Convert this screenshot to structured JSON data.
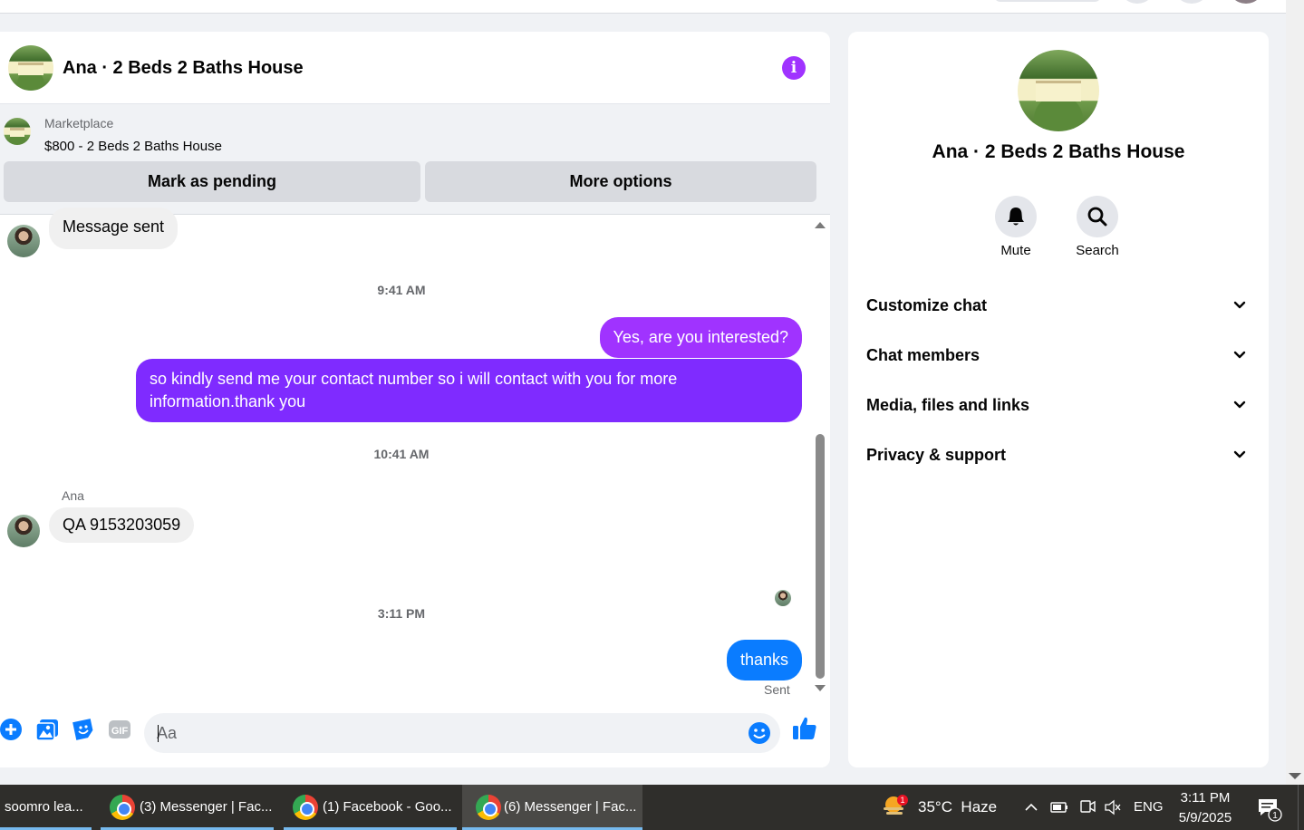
{
  "chat": {
    "title": "Ana · 2 Beds 2 Baths House",
    "info_icon": "info-icon",
    "marketplace": {
      "label": "Marketplace",
      "listing": "$800 - 2 Beds 2 Baths House",
      "mark_pending": "Mark as pending",
      "more_options": "More options"
    },
    "messages": {
      "msg1": "Message sent",
      "time1": "9:41 AM",
      "msg2": "Yes, are you interested?",
      "msg3": "so kindly send me your contact number so i will contact with you for more information.thank you",
      "time2": "10:41 AM",
      "sender": "Ana",
      "msg4": "QA 9153203059",
      "time3": "3:11 PM",
      "msg5": "thanks",
      "status": "Sent"
    },
    "composer": {
      "placeholder": "Aa",
      "icons": [
        "plus-icon",
        "image-icon",
        "sticker-icon",
        "gif-icon",
        "emoji-icon",
        "thumbs-up-icon"
      ],
      "gif_label": "GIF"
    }
  },
  "details": {
    "title": "Ana · 2 Beds 2 Baths House",
    "mute": "Mute",
    "search": "Search",
    "rows": [
      "Customize chat",
      "Chat members",
      "Media, files and links",
      "Privacy & support"
    ]
  },
  "taskbar": {
    "tasks": [
      "soomro lea...",
      "(3) Messenger | Fac...",
      "(1) Facebook - Goo...",
      "(6) Messenger | Fac..."
    ],
    "weather": "35°C  Haze",
    "weather_badge": "1",
    "lang": "ENG",
    "time": "3:11 PM",
    "date": "5/9/2025",
    "notif_count": "1"
  },
  "colors": {
    "accent_blue": "#0a7cff",
    "purple": "#7f2bff",
    "info_purple": "#a033ff",
    "taskbar": "#2f2e2b"
  }
}
